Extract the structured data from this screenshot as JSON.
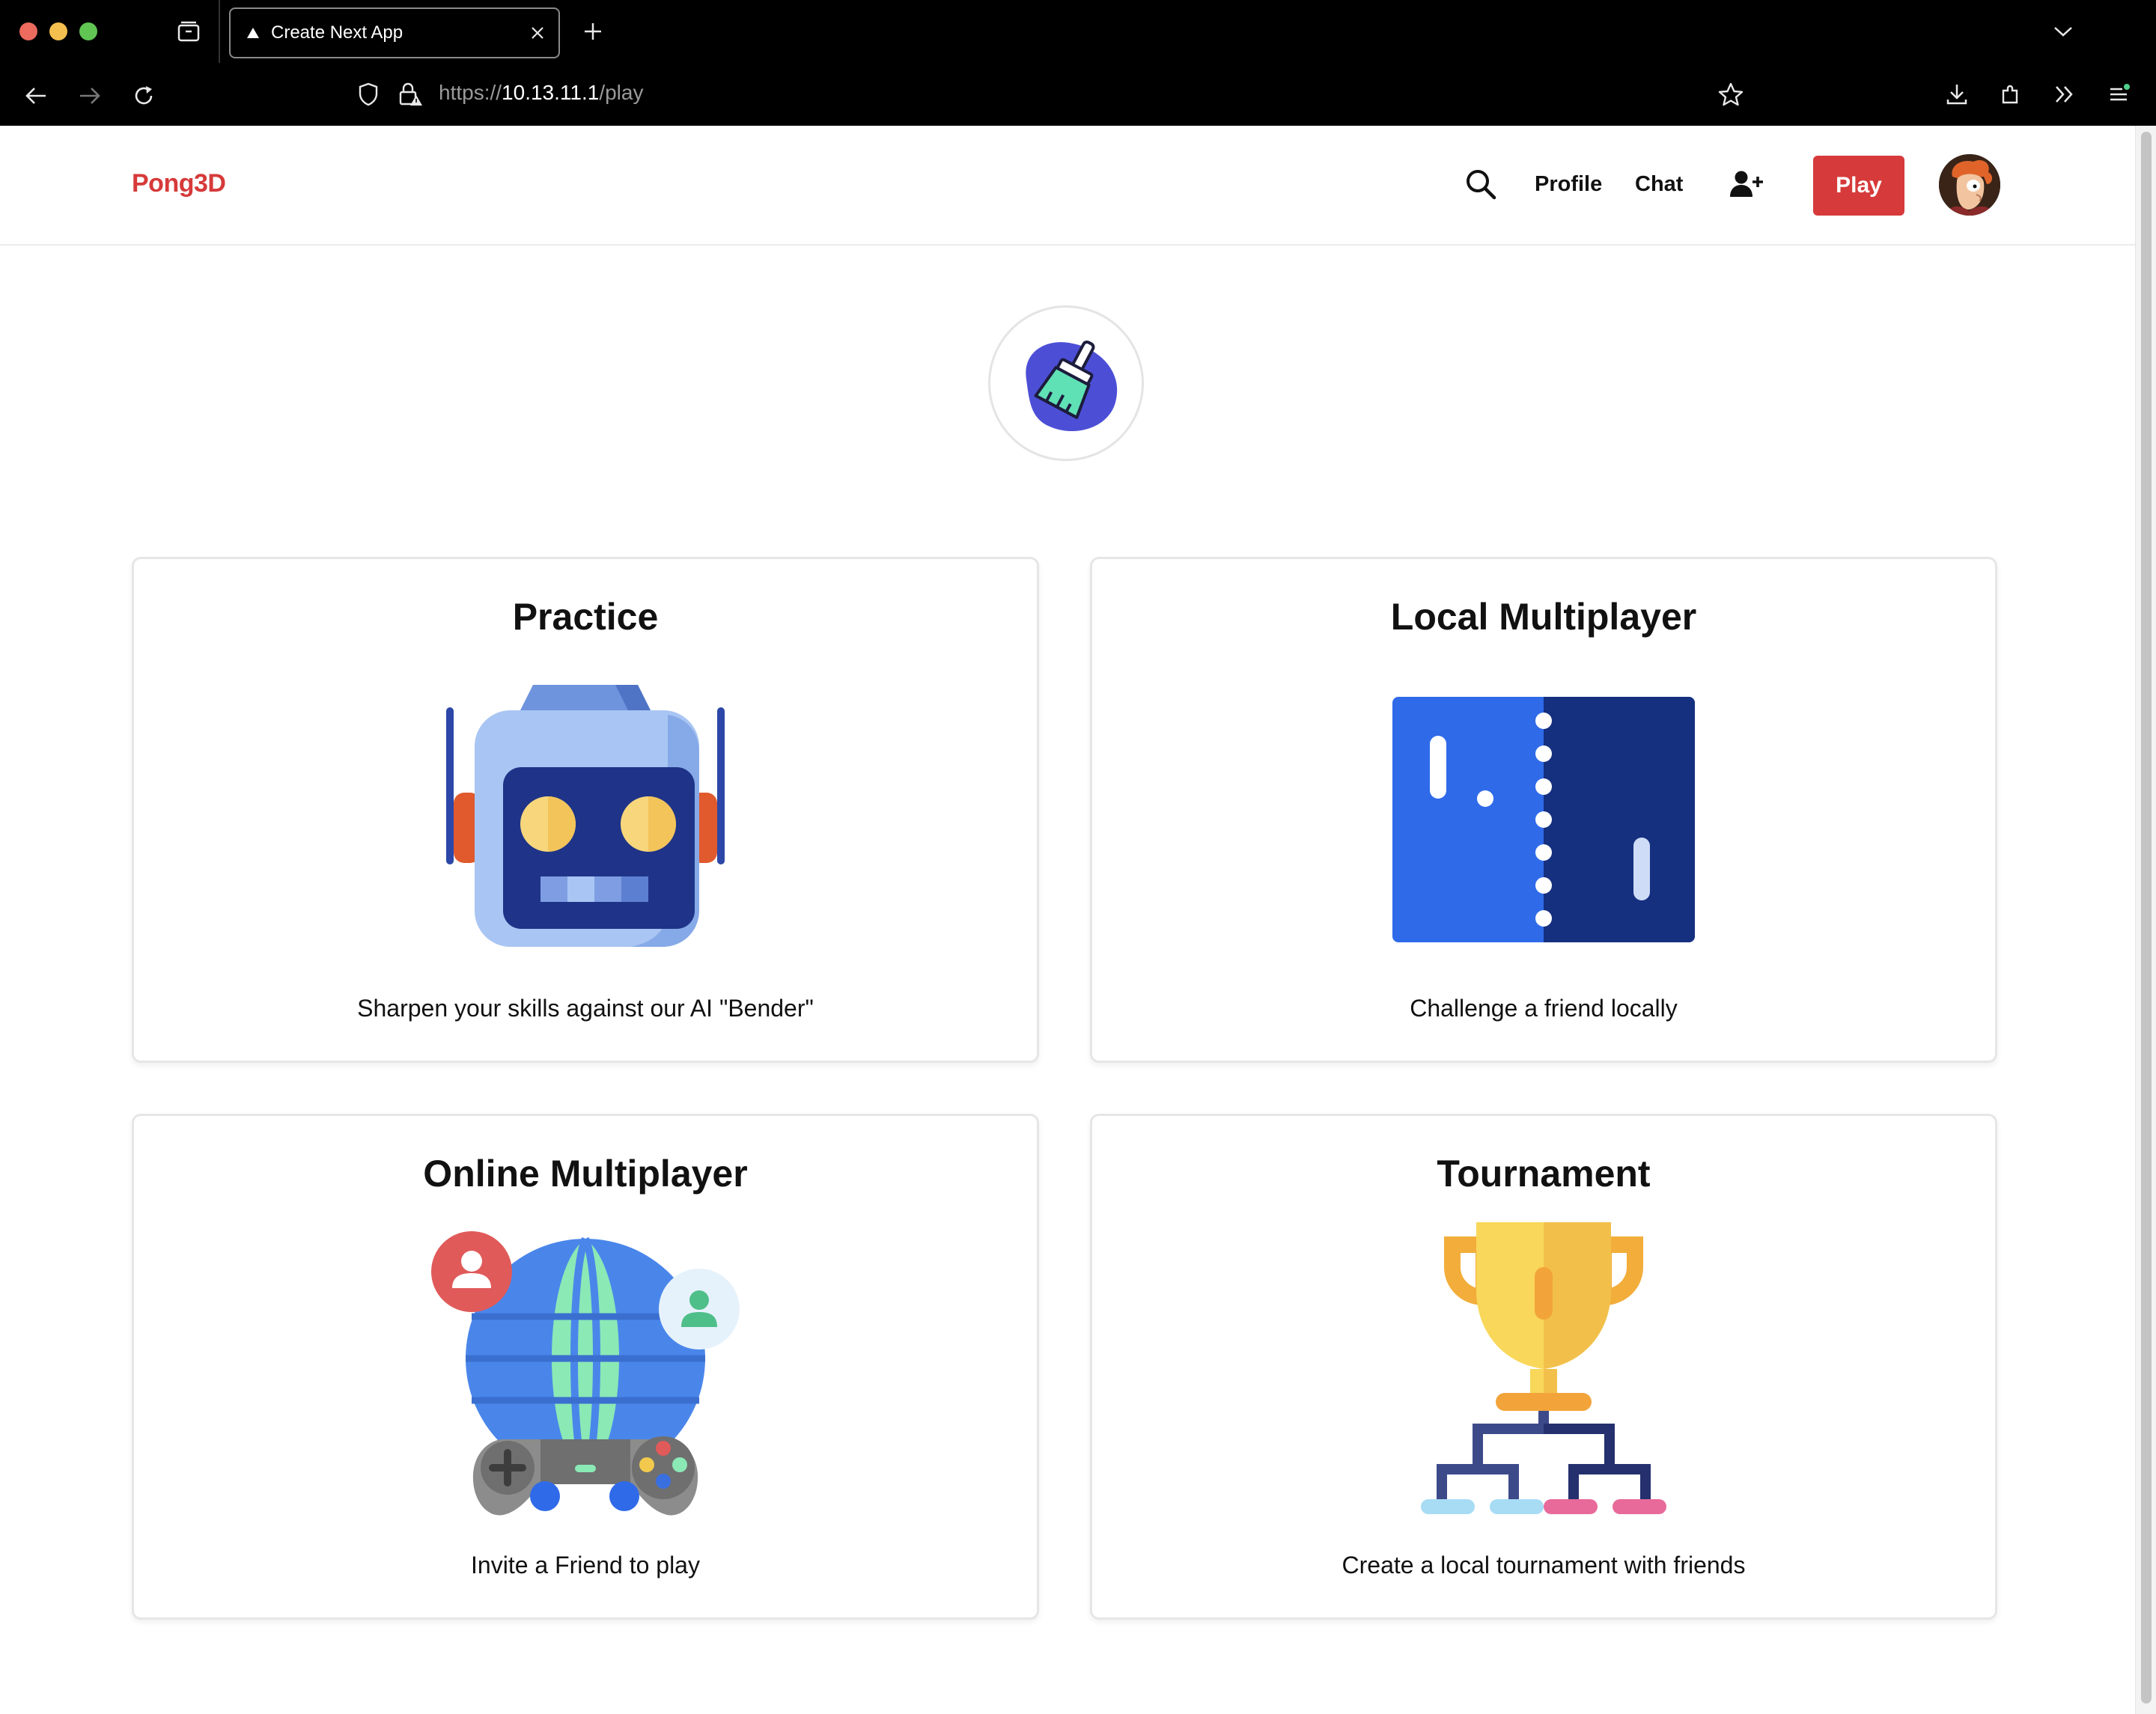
{
  "browser": {
    "tab_title": "Create Next App",
    "url_prefix": "https://",
    "url_host": "10.13.11.1",
    "url_path": "/play"
  },
  "navbar": {
    "brand": "Pong3D",
    "profile_label": "Profile",
    "chat_label": "Chat",
    "play_label": "Play"
  },
  "modes": [
    {
      "title": "Practice",
      "description": "Sharpen your skills against our AI \"Bender\"",
      "icon": "robot-icon"
    },
    {
      "title": "Local Multiplayer",
      "description": "Challenge a friend locally",
      "icon": "pong-court-icon"
    },
    {
      "title": "Online Multiplayer",
      "description": "Invite a Friend to play",
      "icon": "globe-gamepad-icon"
    },
    {
      "title": "Tournament",
      "description": "Create a local tournament with friends",
      "icon": "trophy-bracket-icon"
    }
  ],
  "colors": {
    "brand": "#d63a3a",
    "play_button": "#d63a3a"
  }
}
